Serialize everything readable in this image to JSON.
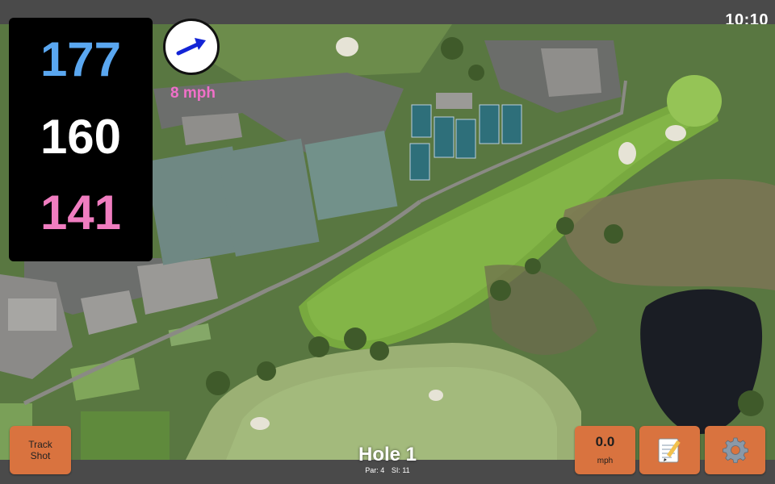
{
  "status": {
    "time": "10:10"
  },
  "distances": {
    "back": "177",
    "middle": "160",
    "front": "141"
  },
  "wind": {
    "speed": "8 mph",
    "direction_icon": "arrow-right-icon"
  },
  "hole": {
    "title": "Hole 1",
    "par": "Par: 4",
    "si": "SI: 11"
  },
  "buttons": {
    "track_shot": [
      "Track",
      "Shot"
    ],
    "speed_value": "0.0",
    "speed_unit": "mph",
    "notes_icon": "notepad-icon",
    "settings_icon": "gear-icon"
  },
  "colors": {
    "back_distance": "#5aa7f0",
    "middle_distance": "#ffffff",
    "front_distance": "#f07dc0",
    "button": "#d9733f",
    "wind_text": "#f070c8"
  },
  "map": {
    "type": "satellite-aerial",
    "features": [
      "fairway",
      "green",
      "bunkers",
      "pond",
      "tennis-courts",
      "clubhouse",
      "parking-lot"
    ]
  }
}
